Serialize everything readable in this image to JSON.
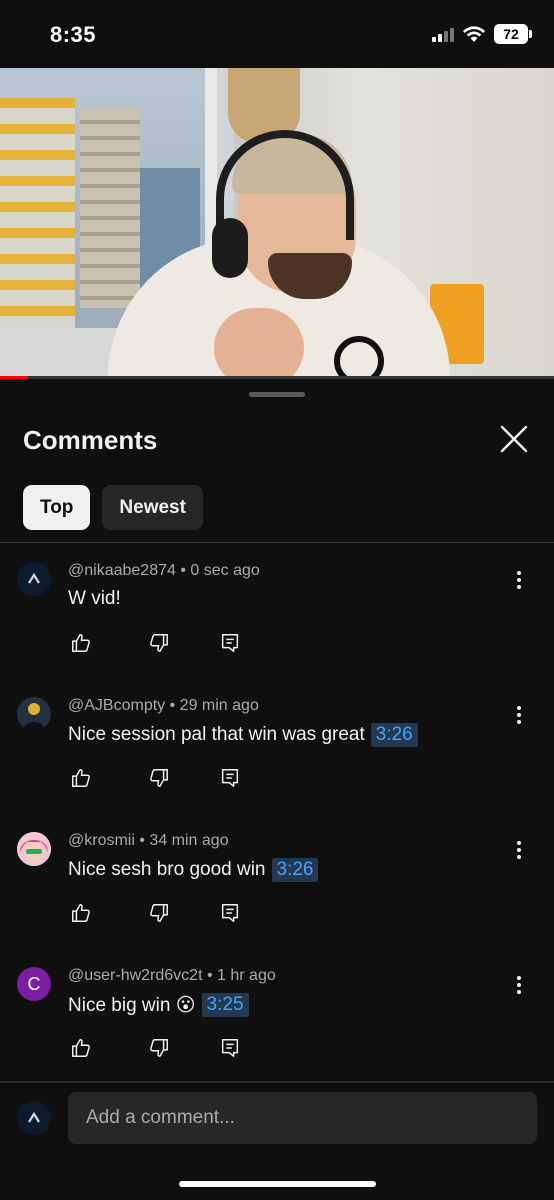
{
  "status_bar": {
    "time": "8:35",
    "battery": "72",
    "icons": [
      "signal-icon",
      "wifi-icon",
      "battery-icon"
    ]
  },
  "video": {
    "progress": 0.05,
    "progress_color": "#ff0000"
  },
  "comments_panel": {
    "title": "Comments",
    "close_icon": "close-icon",
    "chips": [
      {
        "label": "Top",
        "active": true
      },
      {
        "label": "Newest",
        "active": false
      }
    ],
    "comments": [
      {
        "author": "@nikaabe2874",
        "age": "0 sec ago",
        "text": "W vid!",
        "timestamp": "",
        "avatar": "dark-logo-avatar"
      },
      {
        "author": "@AJBcompty",
        "age": "29 min ago",
        "text": "Nice session pal that win was great",
        "timestamp": "3:26",
        "avatar": "photo-avatar"
      },
      {
        "author": "@krosmii",
        "age": "34 min ago",
        "text": "Nice sesh bro good win",
        "timestamp": "3:26",
        "avatar": "pink-hair-avatar"
      },
      {
        "author": "@user-hw2rd6vc2t",
        "age": "1 hr ago",
        "text": "Nice big win 😮",
        "timestamp": "3:25",
        "avatar": "letter-avatar",
        "avatar_letter": "C",
        "avatar_color": "#7b1fa2"
      }
    ],
    "separator": "•",
    "action_icons": [
      "like-icon",
      "dislike-icon",
      "reply-icon"
    ],
    "compose_placeholder": "Add a comment..."
  },
  "colors": {
    "background": "#0f0f0f",
    "timestamp_link": "#3ea6ff",
    "chip_active_bg": "#f1f1f1",
    "chip_inactive_bg": "#272727"
  }
}
